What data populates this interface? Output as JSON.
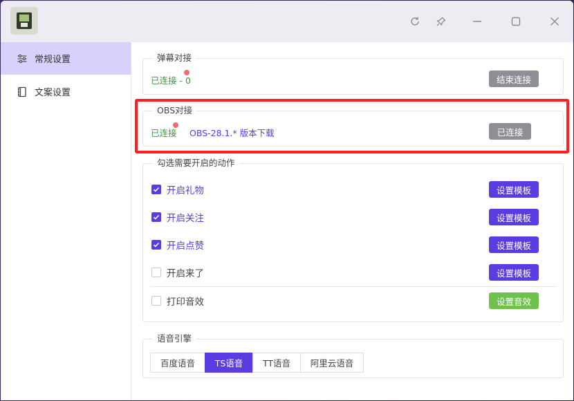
{
  "colors": {
    "accent": "#5a3ce0",
    "connected_green": "#3a9a3a",
    "sound_button_green": "#6cc24a",
    "status_dot_red": "#f06b6b",
    "highlight_red": "#ff2020"
  },
  "titlebar": {
    "icons": [
      "app-icon",
      "refresh-icon",
      "pin-icon",
      "minimize-icon",
      "maximize-icon",
      "close-icon"
    ]
  },
  "sidebar": {
    "items": [
      {
        "label": "常规设置",
        "icon": "sliders-icon",
        "active": true
      },
      {
        "label": "文案设置",
        "icon": "notebook-icon",
        "active": false
      }
    ]
  },
  "danmaku": {
    "legend": "弹幕对接",
    "status": "已连接 - 0",
    "button": "结束连接"
  },
  "obs": {
    "legend": "OBS对接",
    "status": "已连接",
    "link": "OBS-28.1.* 版本下载",
    "button": "已连接"
  },
  "actions": {
    "legend": "勾选需要开启的动作",
    "items": [
      {
        "label": "开启礼物",
        "checked": true,
        "button": "设置模板"
      },
      {
        "label": "开启关注",
        "checked": true,
        "button": "设置模板"
      },
      {
        "label": "开启点赞",
        "checked": true,
        "button": "设置模板"
      },
      {
        "label": "开启来了",
        "checked": false,
        "button": "设置模板"
      },
      {
        "label": "打印音效",
        "checked": false,
        "button": "设置音效"
      }
    ]
  },
  "voice": {
    "legend": "语音引擎",
    "options": [
      "百度语音",
      "TS语音",
      "TT语音",
      "阿里云语音"
    ],
    "selected": "TS语音"
  }
}
